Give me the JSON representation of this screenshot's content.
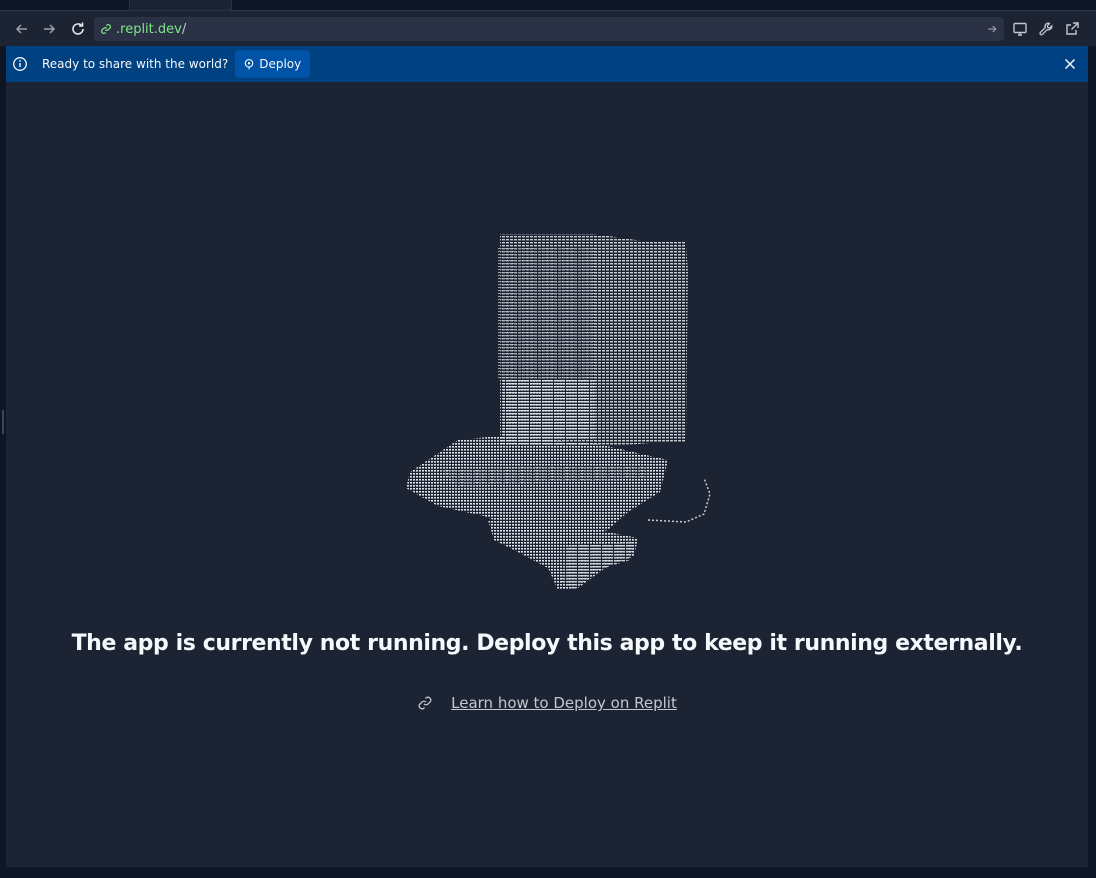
{
  "browser": {
    "url_host": ".replit.dev",
    "url_path": "/"
  },
  "banner": {
    "message": "Ready to share with the world?",
    "deploy_label": "Deploy"
  },
  "main": {
    "headline": "The app is currently not running. Deploy this app to keep it running externally.",
    "learn_link": "Learn how to Deploy on Replit"
  },
  "icons": {
    "back": "arrow-left-icon",
    "forward": "arrow-right-icon",
    "reload": "reload-icon",
    "link": "link-icon",
    "go": "arrow-right-icon",
    "devtools": "monitor-icon",
    "tools": "wrench-icon",
    "open_external": "external-link-icon",
    "info": "info-icon",
    "deploy": "deploy-icon",
    "close": "close-icon"
  },
  "colors": {
    "page_bg": "#0e1525",
    "panel_bg": "#1c2333",
    "banner_bg": "#004182",
    "deploy_button_bg": "#0053a6",
    "url_host": "#7ee787",
    "text_light": "#f5f9fc",
    "text_muted": "#c2c8cc"
  }
}
